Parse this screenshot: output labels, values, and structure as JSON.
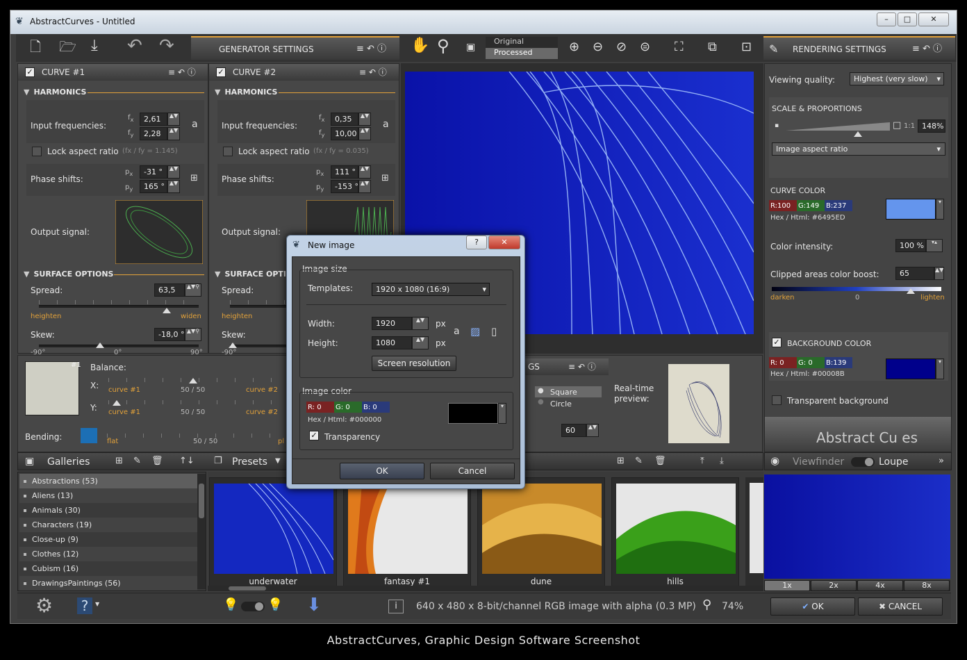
{
  "window": {
    "title": "AbstractCurves - Untitled",
    "min": "–",
    "max": "□",
    "close": "✕"
  },
  "colors": {
    "accent": "#e3a23a",
    "panel": "#474747",
    "curve": "#6495ED",
    "background": "#00008B"
  },
  "toolbar": {
    "generator_settings": "GENERATOR SETTINGS",
    "rendering_settings": "RENDERING SETTINGS",
    "view_original": "Original",
    "view_processed": "Processed"
  },
  "curve1": {
    "title": "CURVE #1",
    "harmonics": "HARMONICS",
    "input_freq": "Input frequencies:",
    "fx": "2,61",
    "fy": "2,28",
    "lock": "Lock aspect ratio",
    "lock_note": "(fx / fy = 1.145)",
    "phase": "Phase shifts:",
    "px": "-31 °",
    "py": "165 °",
    "output": "Output signal:",
    "surface": "SURFACE OPTIONS",
    "spread": "Spread:",
    "spread_val": "63,5",
    "heighten": "heighten",
    "widen": "widen",
    "skew": "Skew:",
    "skew_val": "-18,0 °",
    "t1": "-90°",
    "t2": "0°",
    "t3": "90°"
  },
  "curve2": {
    "title": "CURVE #2",
    "harmonics": "HARMONICS",
    "input_freq": "Input frequencies:",
    "fx": "0,35",
    "fy": "10,00",
    "lock": "Lock aspect ratio",
    "lock_note": "(fx / fy = 0.035)",
    "phase": "Phase shifts:",
    "px": "111 °",
    "py": "-153 °",
    "output": "Output signal:",
    "surface": "SURFACE OPTIO",
    "spread": "Spread:",
    "heighten": "heighten",
    "skew": "Skew:",
    "t1": "-90°"
  },
  "mix": {
    "badge": "#1",
    "balance": "Balance:",
    "x": "X:",
    "y": "Y:",
    "c1": "curve #1",
    "c2": "curve #2",
    "mid": "50 / 50",
    "bending": "Bending:",
    "flat": "flat",
    "pl": "pl"
  },
  "shape": {
    "hdr": "GS",
    "square": "Square",
    "circle": "Circle",
    "val": "60",
    "realtime": "Real-time\npreview:"
  },
  "render": {
    "viewing_quality": "Viewing quality:",
    "quality_val": "Highest (very slow)",
    "scale": "SCALE & PROPORTIONS",
    "one": "1:1",
    "zoom": "148%",
    "aspect": "Image aspect ratio",
    "curve_color": "CURVE COLOR",
    "r": "R:",
    "rv": "100",
    "g": "G:",
    "gv": "149",
    "b": "B:",
    "bv": "237",
    "hex_lbl": "Hex / Html:",
    "hex": "#6495ED",
    "intensity": "Color intensity:",
    "intensity_val": "100 %",
    "boost": "Clipped areas color boost:",
    "boost_val": "65",
    "darken": "darken",
    "zero": "0",
    "lighten": "lighten",
    "bg": "BACKGROUND COLOR",
    "bg_rv": "0",
    "bg_gv": "0",
    "bg_bv": "139",
    "bg_hex": "#00008B",
    "transparent": "Transparent background",
    "logo": "Abstract Cu   es"
  },
  "galleries": {
    "title": "Galleries",
    "presets": "Presets",
    "items": [
      "Abstractions (53)",
      "Aliens (13)",
      "Animals (30)",
      "Characters (19)",
      "Close-up (9)",
      "Clothes (12)",
      "Cubism (16)",
      "DrawingsPaintings (56)"
    ],
    "thumbs": [
      "underwater",
      "fantasy #1",
      "dune",
      "hills"
    ]
  },
  "viewfinder": {
    "title": "Viewfinder",
    "loupe": "Loupe",
    "z1": "1x",
    "z2": "2x",
    "z4": "4x",
    "z8": "8x"
  },
  "status": {
    "info": "640 x 480 x 8-bit/channel RGB image with alpha  (0.3 MP)",
    "zoom": "74%",
    "ok": "OK",
    "cancel": "CANCEL"
  },
  "dialog": {
    "title": "New image",
    "help": "?",
    "close": "✕",
    "image_size": "Image size",
    "templates": "Templates:",
    "template_val": "1920 x 1080  (16:9)",
    "width": "Width:",
    "width_val": "1920",
    "height": "Height:",
    "height_val": "1080",
    "px": "px",
    "screen_res": "Screen resolution",
    "image_color": "Image color",
    "r": "R:",
    "rv": "0",
    "g": "G:",
    "gv": "0",
    "b": "B:",
    "bv": "0",
    "hex_lbl": "Hex / Html:",
    "hex": "#000000",
    "transparency": "Transparency",
    "ok": "OK",
    "cancel": "Cancel"
  },
  "caption": "AbstractCurves, Graphic Design Software Screenshot"
}
